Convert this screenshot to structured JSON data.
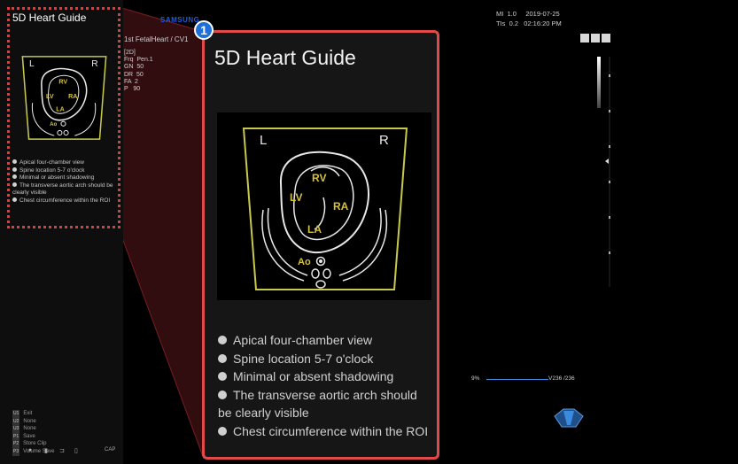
{
  "screen": {
    "brand": "SAMSUNG",
    "probe_label": "1st FetalHeart / CV1",
    "params": [
      "[2D]",
      "Frq  Pen.1",
      "GN  50",
      "DR  50",
      "FA  2",
      "P   90"
    ],
    "status": [
      "MI  1.0     2019-07-25",
      "TIs  0.2   02:16:20 PM"
    ],
    "tgc_left": "9%",
    "tgc_right": "V236 /236"
  },
  "left_panel": {
    "title": "5D Heart Guide",
    "bullets": [
      "Apical four-chamber view",
      "Spine location 5-7 o'clock",
      "Minimal or absent shadowing",
      "The transverse aortic arch should be clearly visible",
      "Chest circumference within the ROI"
    ],
    "keys": [
      {
        "key": "U1",
        "label": "Exit"
      },
      {
        "key": "U2",
        "label": "None"
      },
      {
        "key": "U3",
        "label": "None"
      },
      {
        "key": "P1",
        "label": "Save"
      },
      {
        "key": "P2",
        "label": "Store Clip"
      },
      {
        "key": "P3",
        "label": "Volume Save"
      }
    ],
    "bottom_cap": "CAP"
  },
  "callout": {
    "number": "1",
    "title": "5D Heart Guide",
    "bullets": [
      "Apical four-chamber view",
      "Spine location 5-7 o'clock",
      "Minimal or absent shadowing",
      "The transverse aortic arch should be clearly visible",
      "Chest circumference within the ROI"
    ]
  },
  "diagram_labels": {
    "left": "L",
    "right": "R",
    "rv": "RV",
    "lv": "LV",
    "ra": "RA",
    "la": "LA",
    "ao": "Ao"
  },
  "colors": {
    "highlight": "#e24a4a",
    "badge": "#1e6fd8",
    "diagram_outline": "#c8c84a",
    "chamber_label": "#d6c23a",
    "tgc_line": "#3f8fe0"
  }
}
